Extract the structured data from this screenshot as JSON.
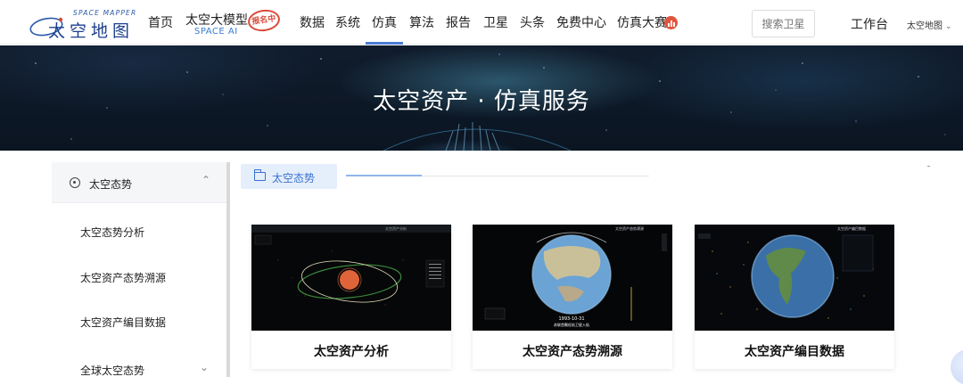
{
  "nav": {
    "logo_en": "SPACE MAPPER",
    "logo_cn": "太空地图",
    "home": "首页",
    "model_title": "太空大模型",
    "model_sub": "SPACE AI",
    "model_badge": "报名中",
    "items": [
      "数据",
      "系统",
      "仿真",
      "算法",
      "报告",
      "卫星",
      "头条",
      "免费中心",
      "仿真大赛"
    ],
    "active_item": "仿真",
    "search_placeholder": "搜索卫星",
    "workbench": "工作台",
    "map_selector": "太空地图"
  },
  "banner": {
    "title": "太空资产 · 仿真服务"
  },
  "sidebar": {
    "group": {
      "label": "太空态势",
      "expanded": true
    },
    "items": [
      "太空态势分析",
      "太空资产态势溯源",
      "太空资产编目数据",
      "全球太空态势"
    ]
  },
  "content": {
    "tag": "太空态势",
    "cards": [
      {
        "title": "太空资产分析",
        "thumb_text": [
          "太空资产分析"
        ]
      },
      {
        "title": "太空资产态势溯源",
        "thumb_text": [
          "太空资产态势溯源",
          "1993-10-31",
          "苏联首颗低轨卫星入轨"
        ]
      },
      {
        "title": "太空资产编目数据",
        "thumb_text": [
          "太空资产编目数据"
        ]
      }
    ]
  },
  "colors": {
    "accent": "#3a72cf",
    "hot": "#e2553d",
    "banner_bg": "#0e1a29"
  }
}
